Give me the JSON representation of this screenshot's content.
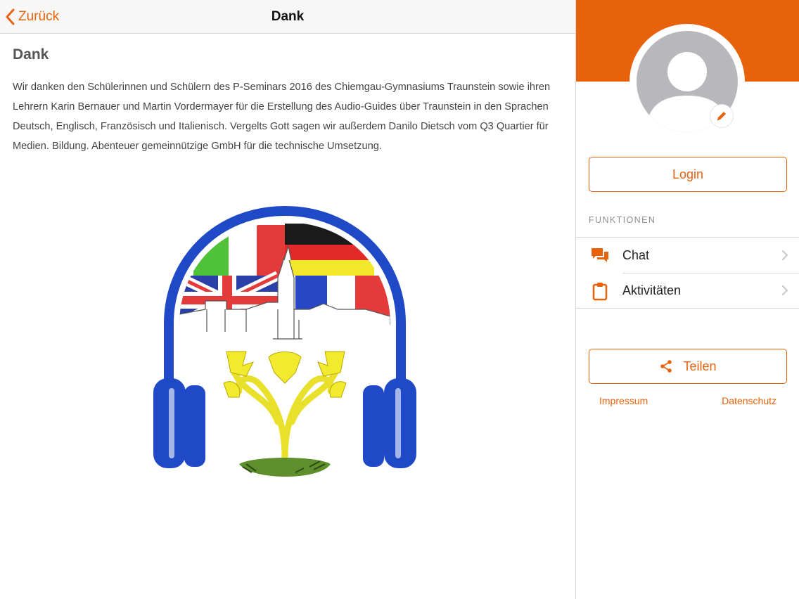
{
  "colors": {
    "accent": "#e8620c",
    "banner": "#e8620c",
    "avatar_placeholder": "#b8b8bc"
  },
  "navbar": {
    "back_label": "Zurück",
    "back_icon": "chevron-left-icon",
    "title": "Dank"
  },
  "content": {
    "heading": "Dank",
    "paragraph": "Wir danken den Schülerinnen und Schülern des P-Seminars 2016 des Chiemgau-Gymnasiums Traunstein sowie ihren Lehrern Karin Bernauer und Martin Vordermayer für die Erstellung des Audio-Guides über Traunstein in den Sprachen Deutsch, Englisch, Französisch und Italienisch. Vergelts Gott sagen wir außerdem Danilo Dietsch vom Q3 Quartier für Medien. Bildung. Abenteuer gemeinnützige GmbH für die technische Umsetzung.",
    "image": "audio-guide-headphones-logo"
  },
  "sidebar": {
    "avatar_icon": "user-avatar-icon",
    "edit_icon": "pencil-icon",
    "login_label": "Login",
    "section_title": "FUNKTIONEN",
    "menu": [
      {
        "label": "Chat",
        "icon": "chat-bubbles-icon"
      },
      {
        "label": "Aktivitäten",
        "icon": "clipboard-icon"
      }
    ],
    "share_label": "Teilen",
    "share_icon": "share-icon",
    "impressum_label": "Impressum",
    "datenschutz_label": "Datenschutz"
  }
}
